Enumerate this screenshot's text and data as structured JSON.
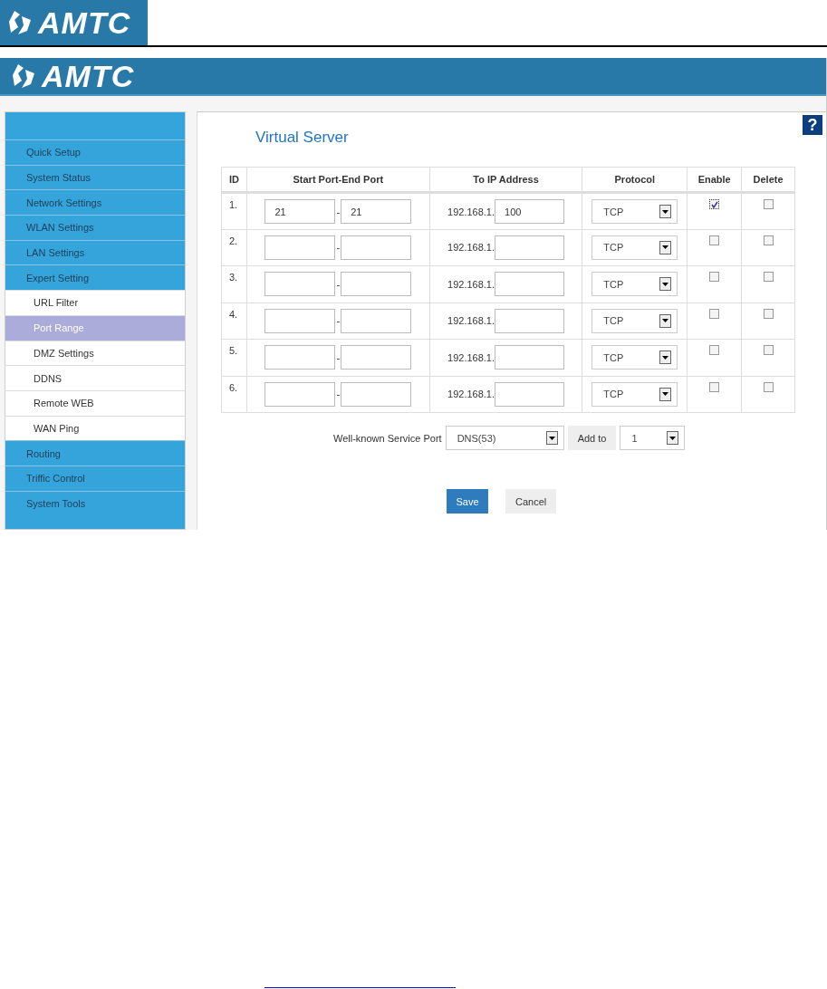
{
  "document_header": {
    "logo": "AMTC"
  },
  "banner": {
    "logo": "AMTC"
  },
  "sidebar": {
    "items": [
      {
        "label": "Quick Setup",
        "selected": false
      },
      {
        "label": "System Status",
        "selected": false
      },
      {
        "label": "Network Settings",
        "selected": false
      },
      {
        "label": "WLAN Settings",
        "selected": false
      },
      {
        "label": "LAN Settings",
        "selected": false
      },
      {
        "label": "Expert Setting",
        "selected": false,
        "children": [
          {
            "label": "URL Filter",
            "selected": false
          },
          {
            "label": "Port Range",
            "selected": true
          },
          {
            "label": "DMZ Settings",
            "selected": false
          },
          {
            "label": "DDNS",
            "selected": false
          },
          {
            "label": "Remote WEB",
            "selected": false
          },
          {
            "label": "WAN Ping",
            "selected": false
          }
        ]
      },
      {
        "label": "Routing",
        "selected": false
      },
      {
        "label": "Triffic Control",
        "selected": false
      },
      {
        "label": "System Tools",
        "selected": false
      }
    ]
  },
  "help_button": "?",
  "title": "Virtual Server",
  "table": {
    "columns": [
      "ID",
      "Start Port-End Port",
      "To IP Address",
      "Protocol",
      "Enable",
      "Delete"
    ],
    "rows": [
      {
        "id": "1.",
        "start_port": "21",
        "separator": "-",
        "end_port": "21",
        "ip_prefix": "192.168.1.",
        "ip_suffix": "100",
        "protocol": "TCP",
        "enable": true,
        "delete": false
      },
      {
        "id": "2.",
        "separator": "-",
        "ip_prefix": "192.168.1.",
        "protocol": "TCP",
        "enable": false,
        "delete": false
      },
      {
        "id": "3.",
        "separator": "-",
        "ip_prefix": "192.168.1.",
        "protocol": "TCP",
        "enable": false,
        "delete": false
      },
      {
        "id": "4.",
        "separator": "-",
        "ip_prefix": "192.168.1.",
        "protocol": "TCP",
        "enable": false,
        "delete": false
      },
      {
        "id": "5.",
        "separator": "-",
        "ip_prefix": "192.168.1.",
        "protocol": "TCP",
        "enable": false,
        "delete": false
      },
      {
        "id": "6.",
        "separator": "-",
        "ip_prefix": "192.168.1.",
        "protocol": "TCP",
        "enable": false,
        "delete": false
      }
    ]
  },
  "well_known": {
    "label": "Well-known Service Port",
    "service": "DNS(53)",
    "add_button": "Add to",
    "target": "1"
  },
  "buttons": {
    "save": "Save",
    "cancel": "Cancel"
  }
}
